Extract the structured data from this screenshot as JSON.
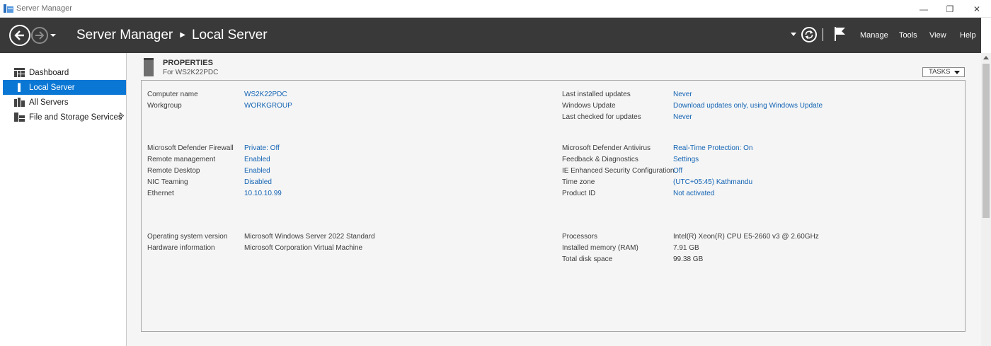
{
  "window": {
    "title": "Server Manager",
    "controls": {
      "minimize": "—",
      "restore": "❐",
      "close": "✕"
    }
  },
  "header": {
    "breadcrumb": [
      "Server Manager",
      "Local Server"
    ],
    "separator": "▶",
    "menu": [
      "Manage",
      "Tools",
      "View",
      "Help"
    ]
  },
  "sidebar": {
    "items": [
      {
        "label": "Dashboard",
        "icon": "dashboard-icon",
        "active": false
      },
      {
        "label": "Local Server",
        "icon": "local-server-icon",
        "active": true
      },
      {
        "label": "All Servers",
        "icon": "all-servers-icon",
        "active": false
      },
      {
        "label": "File and Storage Services",
        "icon": "storage-icon",
        "active": false,
        "expandable": true
      }
    ]
  },
  "properties": {
    "title": "PROPERTIES",
    "subtitle": "For WS2K22PDC",
    "tasks_label": "TASKS",
    "left": [
      {
        "label": "Computer name",
        "value": "WS2K22PDC",
        "link": true
      },
      {
        "label": "Workgroup",
        "value": "WORKGROUP",
        "link": true
      },
      {
        "label": "Microsoft Defender Firewall",
        "value": "Private: Off",
        "link": true
      },
      {
        "label": "Remote management",
        "value": "Enabled",
        "link": true
      },
      {
        "label": "Remote Desktop",
        "value": "Enabled",
        "link": true
      },
      {
        "label": "NIC Teaming",
        "value": "Disabled",
        "link": true
      },
      {
        "label": "Ethernet",
        "value": "10.10.10.99",
        "link": true
      },
      {
        "label": "Operating system version",
        "value": "Microsoft Windows Server 2022 Standard",
        "link": false
      },
      {
        "label": "Hardware information",
        "value": "Microsoft Corporation Virtual Machine",
        "link": false
      }
    ],
    "right": [
      {
        "label": "Last installed updates",
        "value": "Never",
        "link": true
      },
      {
        "label": "Windows Update",
        "value": "Download updates only, using Windows Update",
        "link": true
      },
      {
        "label": "Last checked for updates",
        "value": "Never",
        "link": true
      },
      {
        "label": "Microsoft Defender Antivirus",
        "value": "Real-Time Protection: On",
        "link": true
      },
      {
        "label": "Feedback & Diagnostics",
        "value": "Settings",
        "link": true
      },
      {
        "label": "IE Enhanced Security Configuration",
        "value": "Off",
        "link": true
      },
      {
        "label": "Time zone",
        "value": "(UTC+05:45) Kathmandu",
        "link": true
      },
      {
        "label": "Product ID",
        "value": "Not activated",
        "link": true
      },
      {
        "label": "Processors",
        "value": "Intel(R) Xeon(R) CPU E5-2660 v3 @ 2.60GHz",
        "link": false
      },
      {
        "label": "Installed memory (RAM)",
        "value": "7.91 GB",
        "link": false
      },
      {
        "label": "Total disk space",
        "value": "99.38 GB",
        "link": false
      }
    ]
  },
  "colors": {
    "header_bg": "#393939",
    "accent": "#0a77d4",
    "link": "#1464b4"
  }
}
